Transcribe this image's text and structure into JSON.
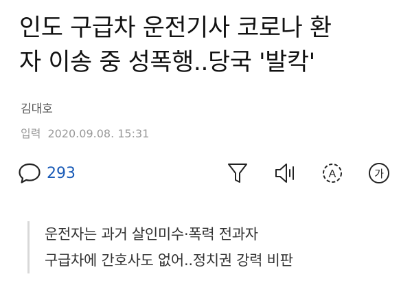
{
  "article": {
    "title_line1": "인도 구급차 운전기사 코로나 환",
    "title_line2": "자 이송 중 성폭행..당국 '발칵'",
    "reporter": "김대호",
    "date_label": "입력",
    "date_value": "2020.09.08. 15:31"
  },
  "toolbar": {
    "comment_count": "293",
    "summary_glyph": "A",
    "fontsize_glyph": "가",
    "icons": [
      "comment-icon",
      "filter-icon",
      "speaker-icon",
      "summary-icon",
      "font-size-icon"
    ]
  },
  "subheads": [
    "운전자는 과거 살인미수·폭력 전과자",
    "구급차에 간호사도 없어..정치권 강력 비판"
  ],
  "colors": {
    "text": "#111111",
    "meta": "#999999",
    "accent": "#1a5bb7",
    "divider": "#d8d8d8"
  }
}
